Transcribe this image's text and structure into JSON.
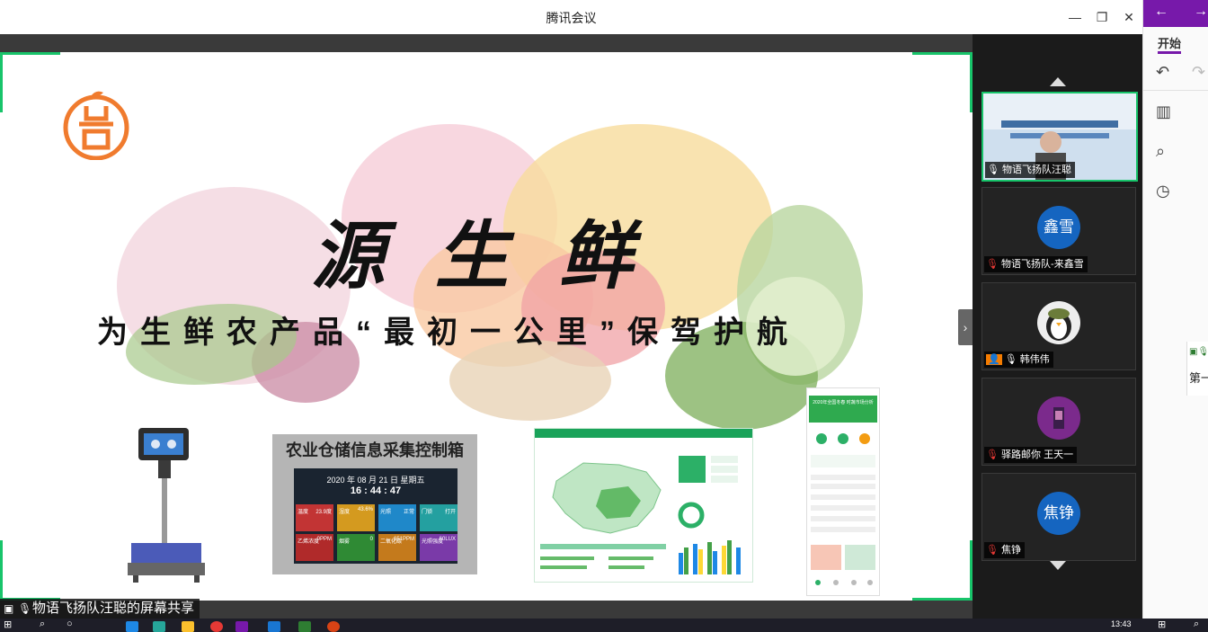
{
  "window": {
    "title": "腾讯会议",
    "minimize": "—",
    "restore": "❐",
    "close": "✕"
  },
  "slide": {
    "title": "源生鲜",
    "subtitle": "为生鲜农产品“最初一公里”保驾护航",
    "device_box_header": "农业仓储信息采集控制箱",
    "device_date": "2020 年 08 月 21 日 星期五",
    "device_time": "16 : 44 : 47",
    "device_cells": [
      {
        "label": "温度",
        "value": "23.9度",
        "color": "#c23434"
      },
      {
        "label": "湿度",
        "value": "43.6%",
        "color": "#d49a1f"
      },
      {
        "label": "光照",
        "value": "正常",
        "color": "#1f88c9"
      },
      {
        "label": "门锁",
        "value": "打开",
        "color": "#24a0a0"
      },
      {
        "label": "乙烯浓度",
        "value": "0PPM",
        "color": "#b02a2a"
      },
      {
        "label": "烟雾",
        "value": "0",
        "color": "#2f8a34"
      },
      {
        "label": "二氧化碳",
        "value": "651PPM",
        "color": "#c47a1c"
      },
      {
        "label": "光照强度",
        "value": "60LUX",
        "color": "#7a3aa8"
      }
    ],
    "phone_banner": "2020年全国冬春 时蔬市场分析"
  },
  "share_label": "物语飞扬队汪聪的屏幕共享",
  "participants": [
    {
      "name": "物语飞扬队汪聪",
      "avatar_text": "",
      "color": "#5a7ea8",
      "video": true
    },
    {
      "name": "物语飞扬队-来鑫雪",
      "avatar_text": "鑫雪",
      "color": "#1565c0",
      "video": false
    },
    {
      "name": "韩伟伟",
      "avatar_text": "",
      "color": "#eeeeee",
      "video": false
    },
    {
      "name": "驿路邮你 王天一",
      "avatar_text": "",
      "color": "#7b2a8c",
      "video": false
    },
    {
      "name": "焦铮",
      "avatar_text": "焦铮",
      "color": "#1565c0",
      "video": false
    }
  ],
  "onenote": {
    "tab": "开始",
    "page_label": "第一"
  },
  "taskbar": {
    "clock": "13:43"
  },
  "colors": {
    "accent_green": "#18c46a",
    "onenote_purple": "#7719aa",
    "avatar_blue": "#1565c0"
  }
}
